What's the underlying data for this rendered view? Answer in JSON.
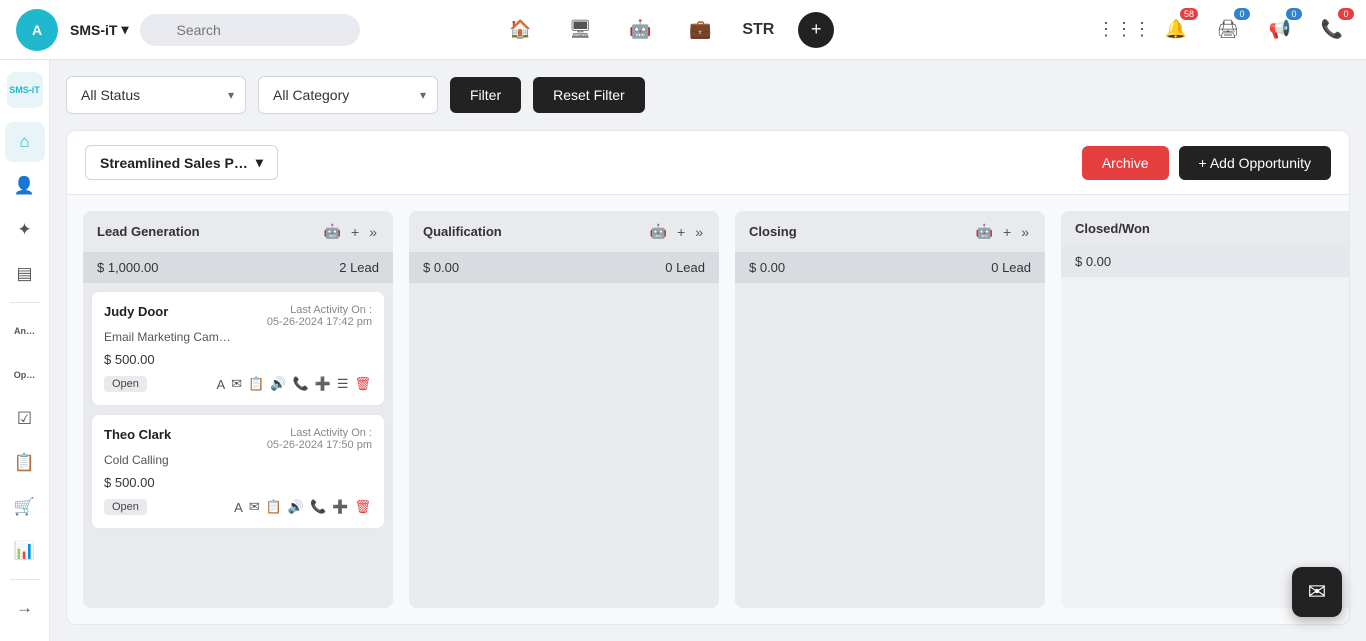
{
  "brand": {
    "name": "SMS-iT",
    "caret": "▾",
    "logo_text": "A"
  },
  "topnav": {
    "search_placeholder": "Search",
    "str_label": "STR",
    "plus_label": "+",
    "badge_messages": "58",
    "badge_notifications1": "0",
    "badge_notifications2": "0",
    "badge_phone": "0"
  },
  "filters": {
    "status_label": "All Status",
    "category_label": "All Category",
    "filter_btn": "Filter",
    "reset_btn": "Reset Filter"
  },
  "pipeline": {
    "title": "Streamlined Sales P…",
    "archive_btn": "Archive",
    "add_opp_btn": "+ Add Opportunity"
  },
  "columns": [
    {
      "id": "lead_generation",
      "title": "Lead Generation",
      "amount": "$ 1,000.00",
      "lead_count": "2 Lead",
      "cards": [
        {
          "name": "Judy Door",
          "sub": "Email Marketing Cam…",
          "activity_label": "Last Activity On :",
          "activity_time": "05-26-2024 17:42 pm",
          "amount": "$ 500.00",
          "status": "Open"
        },
        {
          "name": "Theo Clark",
          "sub": "Cold Calling",
          "activity_label": "Last Activity On :",
          "activity_time": "05-26-2024 17:50 pm",
          "amount": "$ 500.00",
          "status": "Open"
        }
      ]
    },
    {
      "id": "qualification",
      "title": "Qualification",
      "amount": "$ 0.00",
      "lead_count": "0 Lead",
      "cards": []
    },
    {
      "id": "closing",
      "title": "Closing",
      "amount": "$ 0.00",
      "lead_count": "0 Lead",
      "cards": []
    },
    {
      "id": "closed_won",
      "title": "Closed/Won",
      "amount": "$ 0.00",
      "lead_count": "",
      "cards": []
    }
  ],
  "sidebar": {
    "logo_text": "SMS-iT",
    "items": [
      {
        "id": "home",
        "icon": "⌂",
        "label": "Home"
      },
      {
        "id": "user",
        "icon": "👤",
        "label": "User"
      },
      {
        "id": "network",
        "icon": "✦",
        "label": "Network"
      },
      {
        "id": "steps",
        "icon": "▤",
        "label": "Steps"
      },
      {
        "id": "analytics",
        "icon": "An…",
        "label": "Analytics"
      },
      {
        "id": "opportunities",
        "icon": "Op…",
        "label": "Opportunities",
        "active": true
      },
      {
        "id": "calendar",
        "icon": "☑",
        "label": "Calendar"
      },
      {
        "id": "reports",
        "icon": "📋",
        "label": "Reports"
      },
      {
        "id": "cart",
        "icon": "🛒",
        "label": "Cart"
      },
      {
        "id": "charts",
        "icon": "📊",
        "label": "Charts"
      },
      {
        "id": "logout",
        "icon": "→",
        "label": "Logout"
      }
    ]
  },
  "chat_fab": {
    "icon": "✉"
  }
}
